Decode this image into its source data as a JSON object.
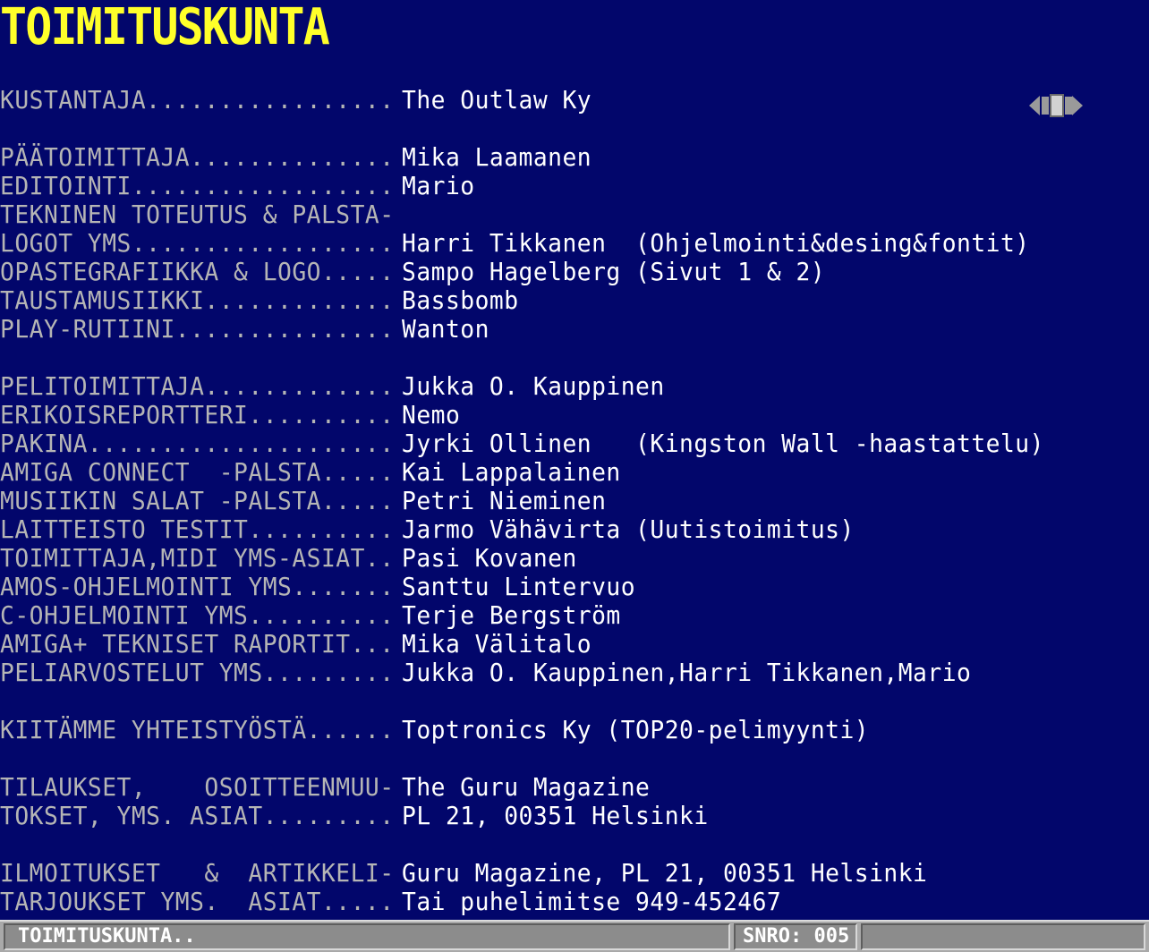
{
  "screen": {
    "title": "TOIMITUSKUNTA",
    "background_color": "#02066b",
    "title_color": "#ffff2a",
    "label_color": "#b5b5b5",
    "value_color": "#ffffff"
  },
  "nav": {
    "icon": "prev-page-next-navigation-icon"
  },
  "rows": [
    {
      "label": "KUSTANTAJA.................",
      "value": "The Outlaw Ky"
    },
    {
      "label": "PÄÄTOIMITTAJA..............",
      "value": "Mika Laamanen"
    },
    {
      "label": "EDITOINTI..................",
      "value": "Mario"
    },
    {
      "label": "TEKNINEN TOTEUTUS & PALSTA-",
      "value": ""
    },
    {
      "label": "LOGOT YMS..................",
      "value": "Harri Tikkanen  (Ohjelmointi&desing&fontit)"
    },
    {
      "label": "OPASTEGRAFIIKKA & LOGO.....",
      "value": "Sampo Hagelberg (Sivut 1 & 2)"
    },
    {
      "label": "TAUSTAMUSIIKKI.............",
      "value": "Bassbomb"
    },
    {
      "label": "PLAY-RUTIINI...............",
      "value": "Wanton"
    },
    {
      "label": "PELITOIMITTAJA.............",
      "value": "Jukka O. Kauppinen"
    },
    {
      "label": "ERIKOISREPORTTERI..........",
      "value": "Nemo"
    },
    {
      "label": "PAKINA.....................",
      "value": "Jyrki Ollinen   (Kingston Wall -haastattelu)"
    },
    {
      "label": "AMIGA CONNECT  -PALSTA.....",
      "value": "Kai Lappalainen"
    },
    {
      "label": "MUSIIKIN SALAT -PALSTA.....",
      "value": "Petri Nieminen"
    },
    {
      "label": "LAITTEISTO TESTIT..........",
      "value": "Jarmo Vähävirta (Uutistoimitus)"
    },
    {
      "label": "TOIMITTAJA,MIDI YMS-ASIAT..",
      "value": "Pasi Kovanen"
    },
    {
      "label": "AMOS-OHJELMOINTI YMS.......",
      "value": "Santtu Lintervuo"
    },
    {
      "label": "C-OHJELMOINTI YMS..........",
      "value": "Terje Bergström"
    },
    {
      "label": "AMIGA+ TEKNISET RAPORTIT...",
      "value": "Mika Välitalo"
    },
    {
      "label": "PELIARVOSTELUT YMS.........",
      "value": "Jukka O. Kauppinen,Harri Tikkanen,Mario"
    },
    {
      "label": "KIITÄMME YHTEISTYÖSTÄ......",
      "value": "Toptronics Ky (TOP20-pelimyynti)"
    },
    {
      "label": "TILAUKSET,    OSOITTEENMUU-",
      "value": "The Guru Magazine"
    },
    {
      "label": "TOKSET, YMS. ASIAT.........",
      "value": "PL 21, 00351 Helsinki"
    },
    {
      "label": "ILMOITUKSET   &  ARTIKKELI-",
      "value": "Guru Magazine, PL 21, 00351 Helsinki"
    },
    {
      "label": "TARJOUKSET YMS.  ASIAT.....",
      "value": "Tai puhelimitse 949-452467"
    }
  ],
  "statusbar": {
    "title": "TOIMITUSKUNTA..",
    "issue": "SNRO: 005",
    "bar_color": "#a9a9a9"
  }
}
